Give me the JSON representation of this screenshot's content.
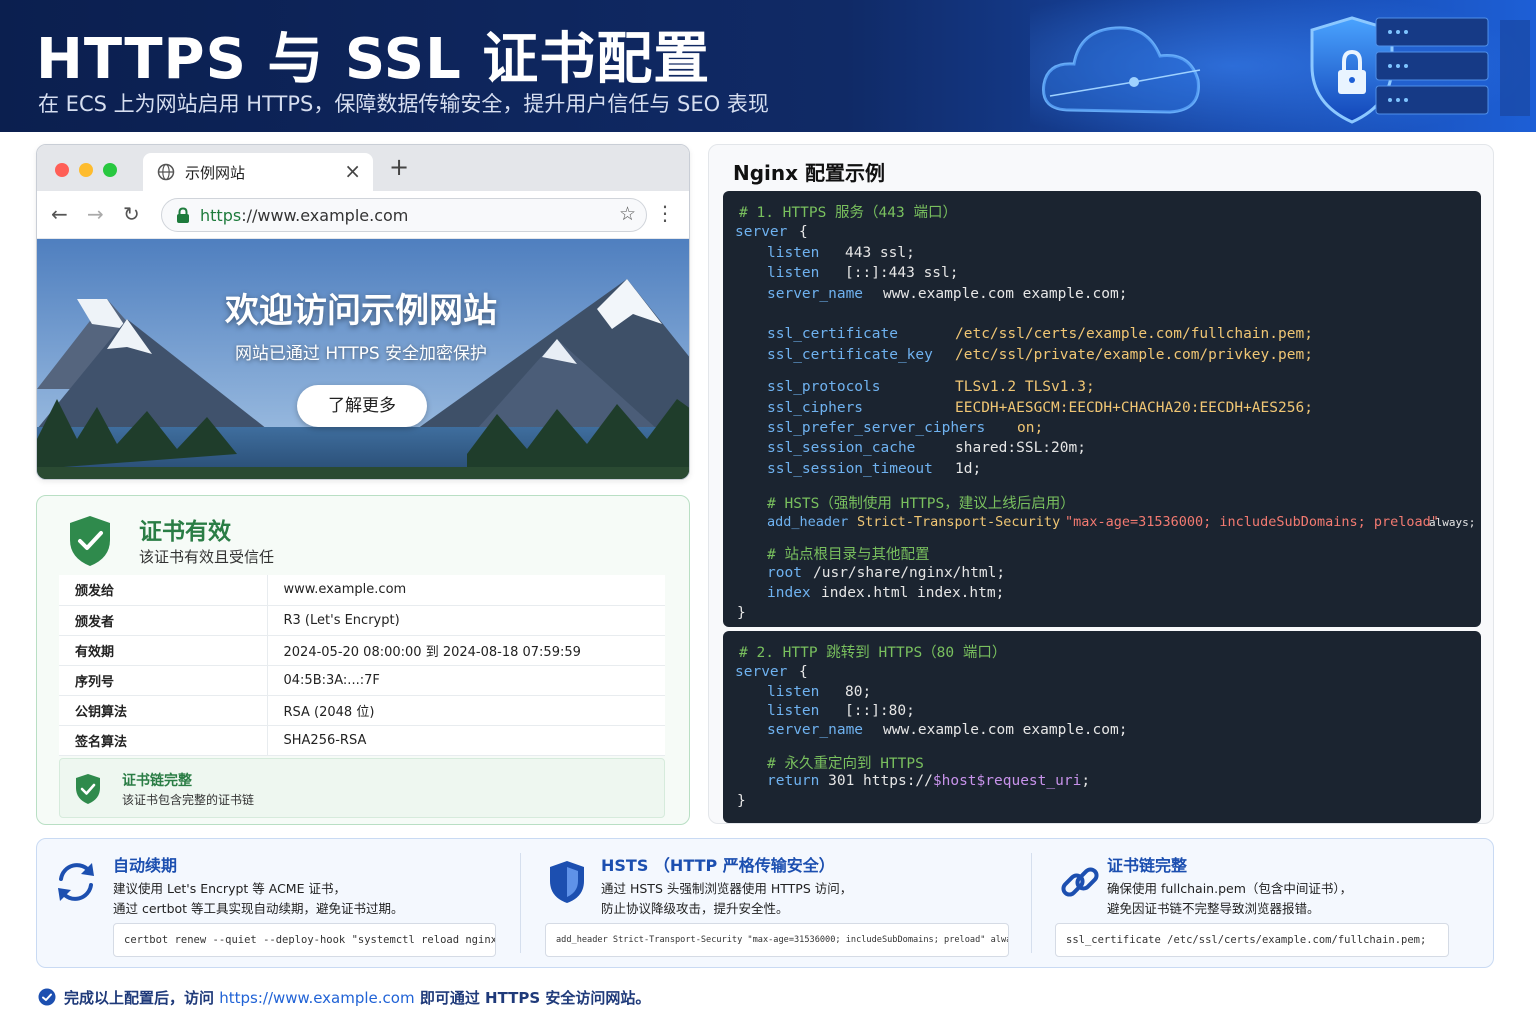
{
  "banner": {
    "title": "HTTPS 与 SSL 证书配置",
    "subtitle": "在 ECS 上为网站启用 HTTPS，保障数据传输安全，提升用户信任与 SEO 表现"
  },
  "browser": {
    "tab_title": "示例网站",
    "url_scheme": "https",
    "url_rest": "://www.example.com",
    "hero_title": "欢迎访问示例网站",
    "hero_subtitle": "网站已通过 HTTPS 安全加密保护",
    "hero_button": "了解更多"
  },
  "certificate": {
    "status_title": "证书有效",
    "status_subtitle": "该证书有效且受信任",
    "rows": [
      {
        "key": "颁发给",
        "value": "www.example.com"
      },
      {
        "key": "颁发者",
        "value": "R3 (Let's Encrypt)"
      },
      {
        "key": "有效期",
        "value": "2024-05-20 08:00:00 到 2024-08-18 07:59:59"
      },
      {
        "key": "序列号",
        "value": "04:5B:3A:...:7F"
      },
      {
        "key": "公钥算法",
        "value": "RSA (2048 位)"
      },
      {
        "key": "签名算法",
        "value": "SHA256-RSA"
      }
    ],
    "chain_title": "证书链完整",
    "chain_subtitle": "该证书包含完整的证书链"
  },
  "nginx": {
    "title": "Nginx 配置示例",
    "block1": {
      "comment": "# 1. HTTPS 服务（443 端口）",
      "server": "server",
      "open": "{",
      "listen_kw": "listen",
      "listen1": "443 ssl;",
      "listen2": "[::]:443 ssl;",
      "server_name_kw": "server_name",
      "server_name": "www.example.com example.com;",
      "ssl_certificate_kw": "ssl_certificate",
      "ssl_certificate": "/etc/ssl/certs/example.com/fullchain.pem;",
      "ssl_certificate_key_kw": "ssl_certificate_key",
      "ssl_certificate_key": "/etc/ssl/private/example.com/privkey.pem;",
      "ssl_protocols_kw": "ssl_protocols",
      "ssl_protocols": "TLSv1.2 TLSv1.3;",
      "ssl_ciphers_kw": "ssl_ciphers",
      "ssl_ciphers": "EECDH+AESGCM:EECDH+CHACHA20:EECDH+AES256;",
      "ssl_prefer_kw": "ssl_prefer_server_ciphers",
      "ssl_prefer": "on;",
      "ssl_cache_kw": "ssl_session_cache",
      "ssl_cache": "shared:SSL:20m;",
      "ssl_timeout_kw": "ssl_session_timeout",
      "ssl_timeout": "1d;",
      "hsts_comment": "# HSTS（强制使用 HTTPS，建议上线后启用）",
      "add_header_kw": "add_header",
      "hsts_name": "Strict-Transport-Security",
      "hsts_value": "\"max-age=31536000; includeSubDomains; preload\"",
      "hsts_always": "always;",
      "root_comment": "# 站点根目录与其他配置",
      "root_kw": "root",
      "root": "/usr/share/nginx/html;",
      "index_kw": "index",
      "index": "index.html index.htm;",
      "close": "}"
    },
    "block2": {
      "comment": "# 2. HTTP 跳转到 HTTPS（80 端口）",
      "server": "server",
      "open": "{",
      "listen_kw": "listen",
      "listen1": "80;",
      "listen2": "[::]:80;",
      "server_name_kw": "server_name",
      "server_name": "www.example.com example.com;",
      "redirect_comment": "# 永久重定向到 HTTPS",
      "return_kw": "return",
      "return_code": "301 https://",
      "var_host": "$host",
      "var_uri": "$request_uri",
      "semi": ";",
      "close": "}"
    }
  },
  "tips": [
    {
      "icon": "refresh-icon",
      "title": "自动续期",
      "line1": "建议使用 Let's Encrypt 等 ACME 证书，",
      "line2": "通过 certbot 等工具实现自动续期，避免证书过期。",
      "code": "certbot renew --quiet --deploy-hook \"systemctl reload nginx\""
    },
    {
      "icon": "shield-icon",
      "title": "HSTS （HTTP 严格传输安全）",
      "line1": "通过 HSTS 头强制浏览器使用 HTTPS 访问，",
      "line2": "防止协议降级攻击，提升安全性。",
      "code": "add_header Strict-Transport-Security \"max-age=31536000; includeSubDomains; preload\" always;"
    },
    {
      "icon": "link-icon",
      "title": "证书链完整",
      "line1": "确保使用 fullchain.pem（包含中间证书），",
      "line2": "避免因证书链不完整导致浏览器报错。",
      "code": "ssl_certificate   /etc/ssl/certs/example.com/fullchain.pem;"
    }
  ],
  "footer": {
    "prefix": "完成以上配置后，访问",
    "link": "https://www.example.com",
    "suffix": "即可通过 HTTPS 安全访问网站。"
  },
  "colors": {
    "banner_bg": "#0b1f4f",
    "accent_blue": "#1c4fb0",
    "success_green": "#2a7d45",
    "code_bg": "#1b2430"
  }
}
